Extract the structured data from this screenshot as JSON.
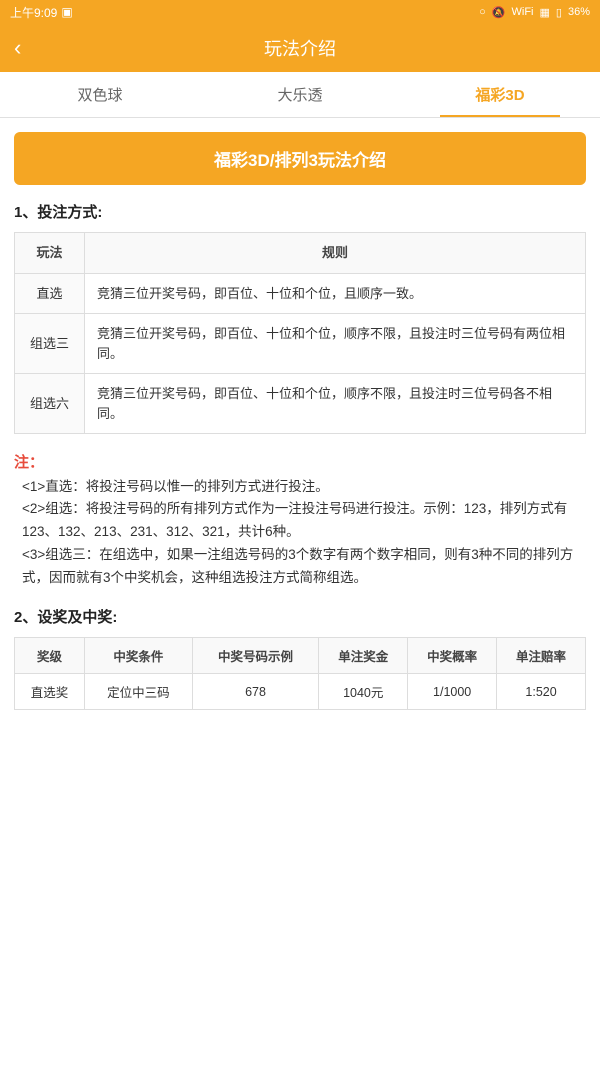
{
  "statusBar": {
    "time": "上午9:09",
    "battery": "36%"
  },
  "header": {
    "back": "‹",
    "title": "玩法介绍"
  },
  "tabs": [
    {
      "id": "tab1",
      "label": "双色球",
      "active": false
    },
    {
      "id": "tab2",
      "label": "大乐透",
      "active": false
    },
    {
      "id": "tab3",
      "label": "福彩3D",
      "active": true
    }
  ],
  "banner": {
    "title": "福彩3D/排列3玩法介绍"
  },
  "section1": {
    "title": "1、投注方式:",
    "tableHeaders": [
      "玩法",
      "规则"
    ],
    "rows": [
      {
        "name": "直选",
        "rule": "竞猜三位开奖号码，即百位、十位和个位，且顺序一致。"
      },
      {
        "name": "组选三",
        "rule": "竞猜三位开奖号码，即百位、十位和个位，顺序不限，且投注时三位号码有两位相同。"
      },
      {
        "name": "组选六",
        "rule": "竞猜三位开奖号码，即百位、十位和个位，顺序不限，且投注时三位号码各不相同。"
      }
    ]
  },
  "notes": {
    "label": "注：",
    "items": [
      "<1>直选：将投注号码以惟一的排列方式进行投注。",
      "<2>组选：将投注号码的所有排列方式作为一注投注号码进行投注。示例：123，排列方式有123、132、213、231、312、321，共计6种。",
      "<3>组选三：在组选中，如果一注组选号码的3个数字有两个数字相同，则有3种不同的排列方式，因而就有3个中奖机会，这种组选投注方式简称组选。"
    ]
  },
  "section2": {
    "title": "2、设奖及中奖:",
    "tableHeaders": [
      "奖级",
      "中奖条件",
      "中奖号码示例",
      "单注奖金",
      "中奖概率",
      "单注赔率"
    ],
    "rows": [
      {
        "level": "直选奖",
        "condition": "定位中三码",
        "example": "678",
        "prize": "1040元",
        "odds": "1/1000",
        "payout": "1:520"
      }
    ]
  }
}
